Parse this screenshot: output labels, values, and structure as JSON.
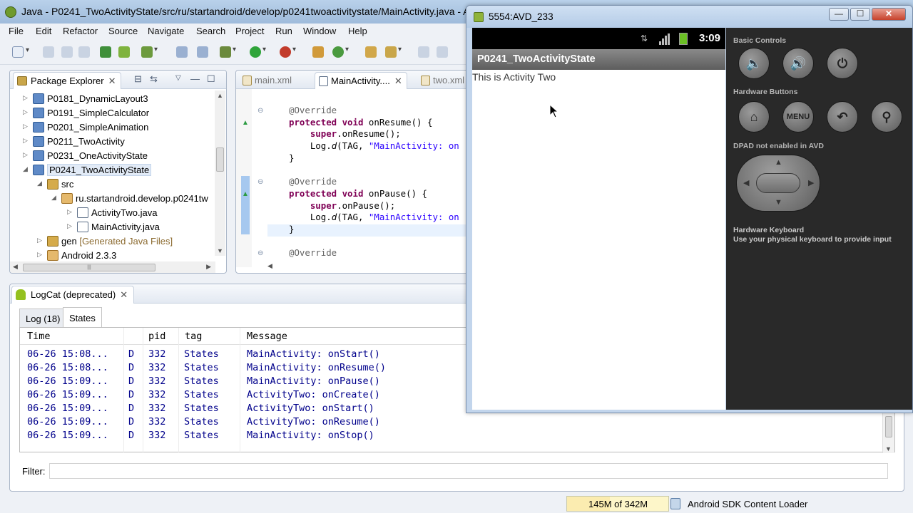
{
  "eclipse": {
    "title": "Java - P0241_TwoActivityState/src/ru/startandroid/develop/p0241twoactivitystate/MainActivity.java - ADT",
    "menu": [
      "File",
      "Edit",
      "Refactor",
      "Source",
      "Navigate",
      "Search",
      "Project",
      "Run",
      "Window",
      "Help"
    ]
  },
  "package_explorer": {
    "tab_label": "Package Explorer",
    "items": [
      {
        "label": "P0181_DynamicLayout3"
      },
      {
        "label": "P0191_SimpleCalculator"
      },
      {
        "label": "P0201_SimpleAnimation"
      },
      {
        "label": "P0211_TwoActivity"
      },
      {
        "label": "P0231_OneActivityState"
      },
      {
        "label": "P0241_TwoActivityState"
      },
      {
        "label": "src"
      },
      {
        "label": "ru.startandroid.develop.p0241tw"
      },
      {
        "label": "ActivityTwo.java"
      },
      {
        "label": "MainActivity.java"
      },
      {
        "label": "gen",
        "suffix": "[Generated Java Files]"
      },
      {
        "label": "Android 2.3.3"
      }
    ]
  },
  "editor": {
    "tabs": [
      "main.xml",
      "MainActivity....",
      "two.xml"
    ],
    "code": {
      "ann1": "@Override",
      "l1_kw": "protected void",
      "l1_rest": " onResume() {",
      "l2_kw": "super",
      "l2_rest": ".onResume();",
      "l3_a": "Log.",
      "l3_b": "d",
      "l3_c": "(TAG, ",
      "l3_str": "\"MainActivity: on",
      "l4": "}",
      "ann2": "@Override",
      "l5_kw": "protected void",
      "l5_rest": " onPause() {",
      "l6_kw": "super",
      "l6_rest": ".onPause();",
      "l7_a": "Log.",
      "l7_b": "d",
      "l7_c": "(TAG, ",
      "l7_str": "\"MainActivity: on",
      "l8": "}",
      "ann3": "@Override"
    }
  },
  "logcat": {
    "tab_label": "LogCat (deprecated)",
    "sub_tabs": [
      "Log (18)",
      "States"
    ],
    "columns": [
      "Time",
      "pid",
      "tag",
      "Message"
    ],
    "rows": [
      {
        "time": "06-26 15:08...",
        "level": "D",
        "pid": "332",
        "tag": "States",
        "msg": "MainActivity: onStart()"
      },
      {
        "time": "06-26 15:08...",
        "level": "D",
        "pid": "332",
        "tag": "States",
        "msg": "MainActivity: onResume()"
      },
      {
        "time": "06-26 15:09...",
        "level": "D",
        "pid": "332",
        "tag": "States",
        "msg": "MainActivity: onPause()"
      },
      {
        "time": "06-26 15:09...",
        "level": "D",
        "pid": "332",
        "tag": "States",
        "msg": "ActivityTwo: onCreate()"
      },
      {
        "time": "06-26 15:09...",
        "level": "D",
        "pid": "332",
        "tag": "States",
        "msg": "ActivityTwo: onStart()"
      },
      {
        "time": "06-26 15:09...",
        "level": "D",
        "pid": "332",
        "tag": "States",
        "msg": "ActivityTwo: onResume()"
      },
      {
        "time": "06-26 15:09...",
        "level": "D",
        "pid": "332",
        "tag": "States",
        "msg": "MainActivity: onStop()"
      }
    ],
    "filter_label": "Filter:",
    "filter_value": ""
  },
  "status": {
    "heap": "145M of 342M",
    "heap_fraction": 0.42,
    "loader": "Android SDK Content Loader"
  },
  "emulator": {
    "title": "5554:AVD_233",
    "clock": "3:09",
    "app_title": "P0241_TwoActivityState",
    "content_text": "This is Activity Two",
    "basic_controls_label": "Basic Controls",
    "hardware_buttons_label": "Hardware Buttons",
    "menu_button": "MENU",
    "dpad_label": "DPAD not enabled in AVD",
    "keyboard_title": "Hardware Keyboard",
    "keyboard_sub": "Use your physical keyboard to provide input"
  }
}
